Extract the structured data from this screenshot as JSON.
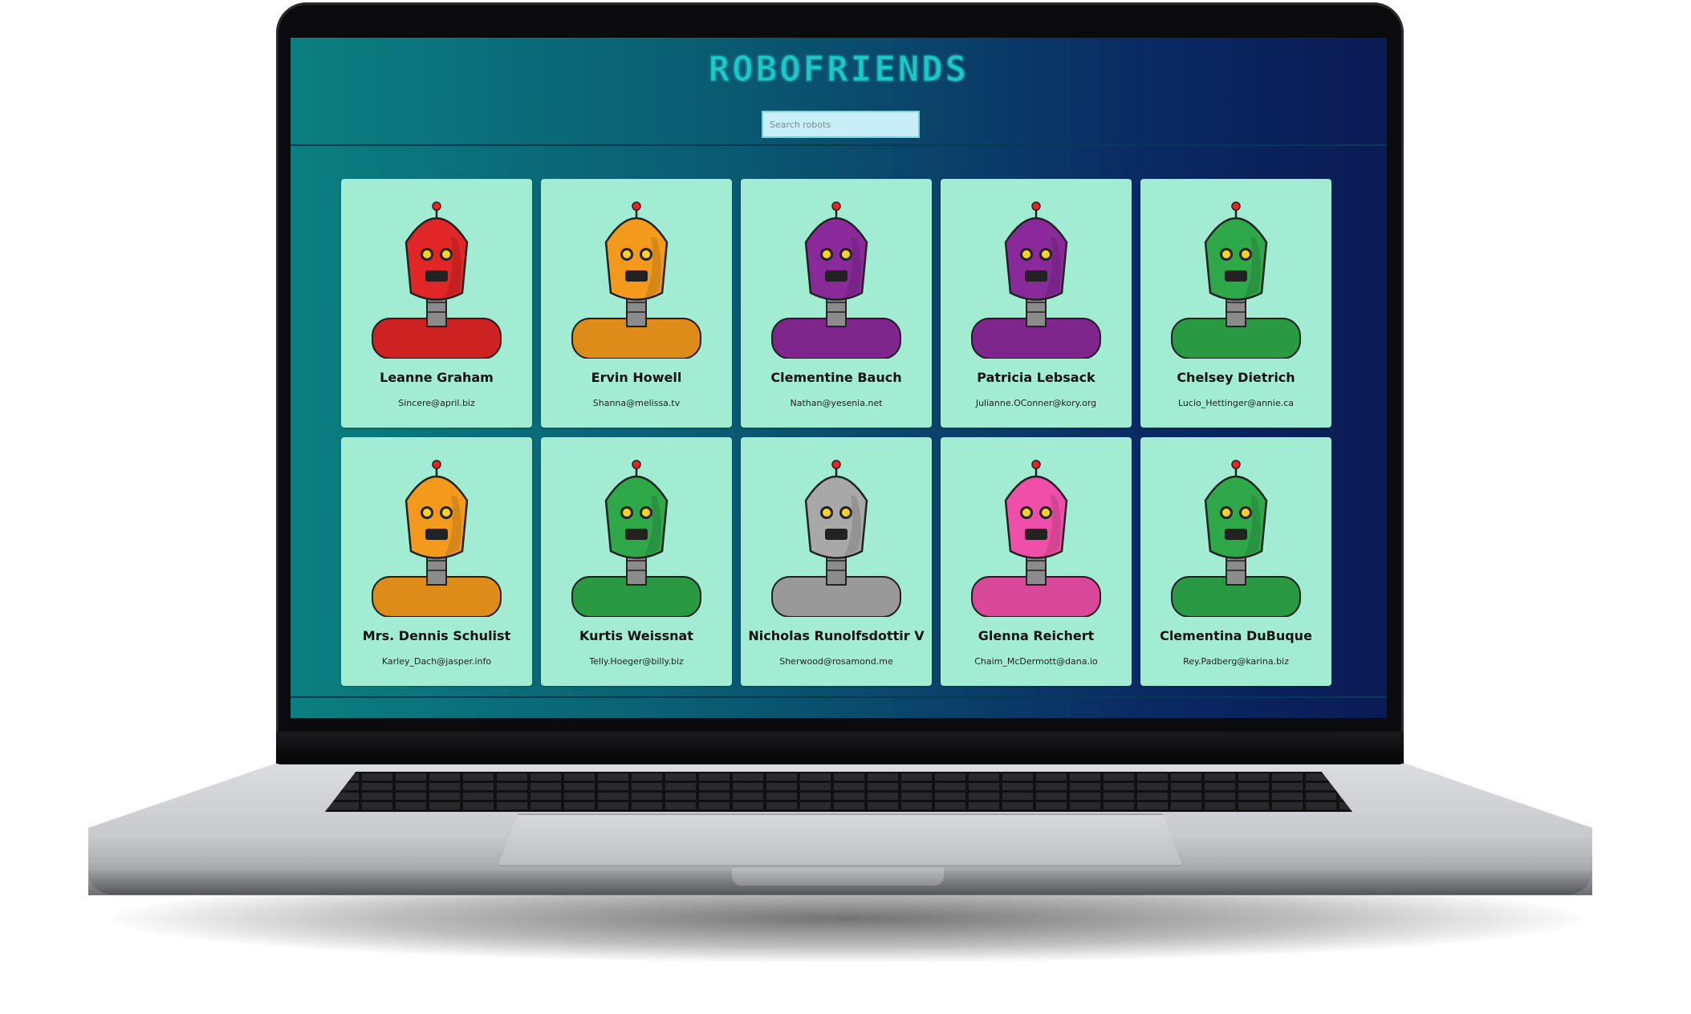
{
  "app": {
    "title": "ROBOFRIENDS",
    "search_placeholder": "Search robots"
  },
  "robots": [
    {
      "name": "Leanne Graham",
      "email": "Sincere@april.biz",
      "color": "#e02626",
      "icon": "red-robot-icon"
    },
    {
      "name": "Ervin Howell",
      "email": "Shanna@melissa.tv",
      "color": "#f39a1c",
      "icon": "orange-robot-icon"
    },
    {
      "name": "Clementine Bauch",
      "email": "Nathan@yesenia.net",
      "color": "#8a2a9a",
      "icon": "purple-robot-icon"
    },
    {
      "name": "Patricia Lebsack",
      "email": "Julianne.OConner@kory.org",
      "color": "#8a2a9a",
      "icon": "purple-robot-icon"
    },
    {
      "name": "Chelsey Dietrich",
      "email": "Lucio_Hettinger@annie.ca",
      "color": "#2fa84a",
      "icon": "green-robot-icon"
    },
    {
      "name": "Mrs. Dennis Schulist",
      "email": "Karley_Dach@jasper.info",
      "color": "#f39a1c",
      "icon": "orange-robot-icon"
    },
    {
      "name": "Kurtis Weissnat",
      "email": "Telly.Hoeger@billy.biz",
      "color": "#2fa84a",
      "icon": "green-robot-icon"
    },
    {
      "name": "Nicholas Runolfsdottir V",
      "email": "Sherwood@rosamond.me",
      "color": "#a8a8a8",
      "icon": "grey-robot-icon"
    },
    {
      "name": "Glenna Reichert",
      "email": "Chaim_McDermott@dana.io",
      "color": "#ef4fa8",
      "icon": "pink-robot-icon"
    },
    {
      "name": "Clementina DuBuque",
      "email": "Rey.Padberg@karina.biz",
      "color": "#2fa84a",
      "icon": "green-robot-icon"
    }
  ]
}
